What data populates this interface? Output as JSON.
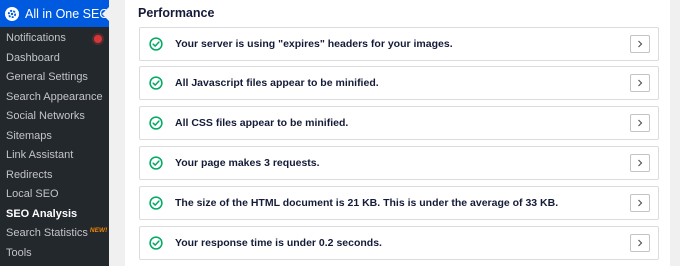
{
  "sidebar": {
    "title": "All in One SEO",
    "items": [
      {
        "label": "Notifications"
      },
      {
        "label": "Dashboard"
      },
      {
        "label": "General Settings"
      },
      {
        "label": "Search Appearance"
      },
      {
        "label": "Social Networks"
      },
      {
        "label": "Sitemaps"
      },
      {
        "label": "Link Assistant"
      },
      {
        "label": "Redirects"
      },
      {
        "label": "Local SEO"
      },
      {
        "label": "SEO Analysis"
      },
      {
        "label": "Search Statistics",
        "badge": "NEW!"
      },
      {
        "label": "Tools"
      }
    ],
    "active_item": "SEO Analysis"
  },
  "main": {
    "section_title": "Performance",
    "checks": [
      {
        "status": "pass",
        "text": "Your server is using \"expires\" headers for your images."
      },
      {
        "status": "pass",
        "text": "All Javascript files appear to be minified."
      },
      {
        "status": "pass",
        "text": "All CSS files appear to be minified."
      },
      {
        "status": "pass",
        "text": "Your page makes 3 requests."
      },
      {
        "status": "pass",
        "text": "The size of the HTML document is 21 KB. This is under the average of 33 KB."
      },
      {
        "status": "pass",
        "text": "Your response time is under 0.2 seconds."
      }
    ]
  },
  "colors": {
    "sidebar_bg": "#23282d",
    "plugin_header_bg": "#005ae0",
    "pass_green": "#00aa63",
    "notification_red": "#d63638",
    "new_badge": "#f18500"
  },
  "icons": {
    "logo": "aioseo-gear-icon",
    "check": "check-circle-icon",
    "expand": "chevron-right-icon"
  }
}
